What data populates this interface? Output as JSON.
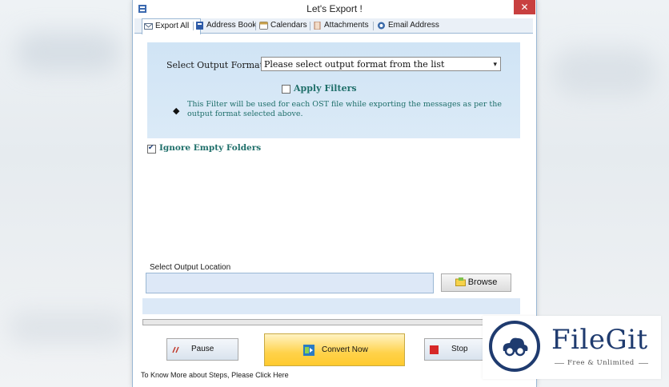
{
  "window": {
    "title": "Let's Export !",
    "close_glyph": "✕"
  },
  "tabs": [
    {
      "label": "Export All",
      "icon": "envelope-icon"
    },
    {
      "label": "Address Book",
      "icon": "address-book-icon"
    },
    {
      "label": "Calendars",
      "icon": "calendar-icon"
    },
    {
      "label": "Attachments",
      "icon": "paperclip-icon"
    },
    {
      "label": "Email Address",
      "icon": "at-icon"
    }
  ],
  "form": {
    "format_label": "Select Output Format",
    "format_value": "Please select output format from the list",
    "apply_filters_label": "Apply Filters",
    "apply_filters_checked": false,
    "filter_note": "This Filter will be used for each OST file while exporting the messages as per the output format selected above.",
    "ignore_empty_label": "Ignore Empty Folders",
    "ignore_empty_checked": true,
    "location_label": "Select Output Location",
    "location_value": "",
    "browse_label": "Browse"
  },
  "buttons": {
    "pause": "Pause",
    "convert": "Convert Now",
    "stop": "Stop"
  },
  "footer": {
    "help_text": "To Know More about Steps, Please Click Here"
  },
  "watermark": {
    "name": "FileGit",
    "tagline": "Free & Unlimited"
  },
  "colors": {
    "accent_teal": "#1f6f6a",
    "panel_blue": "#d6e7f6",
    "convert_yellow": "#ffd24a",
    "logo_navy": "#1f3b6f"
  }
}
